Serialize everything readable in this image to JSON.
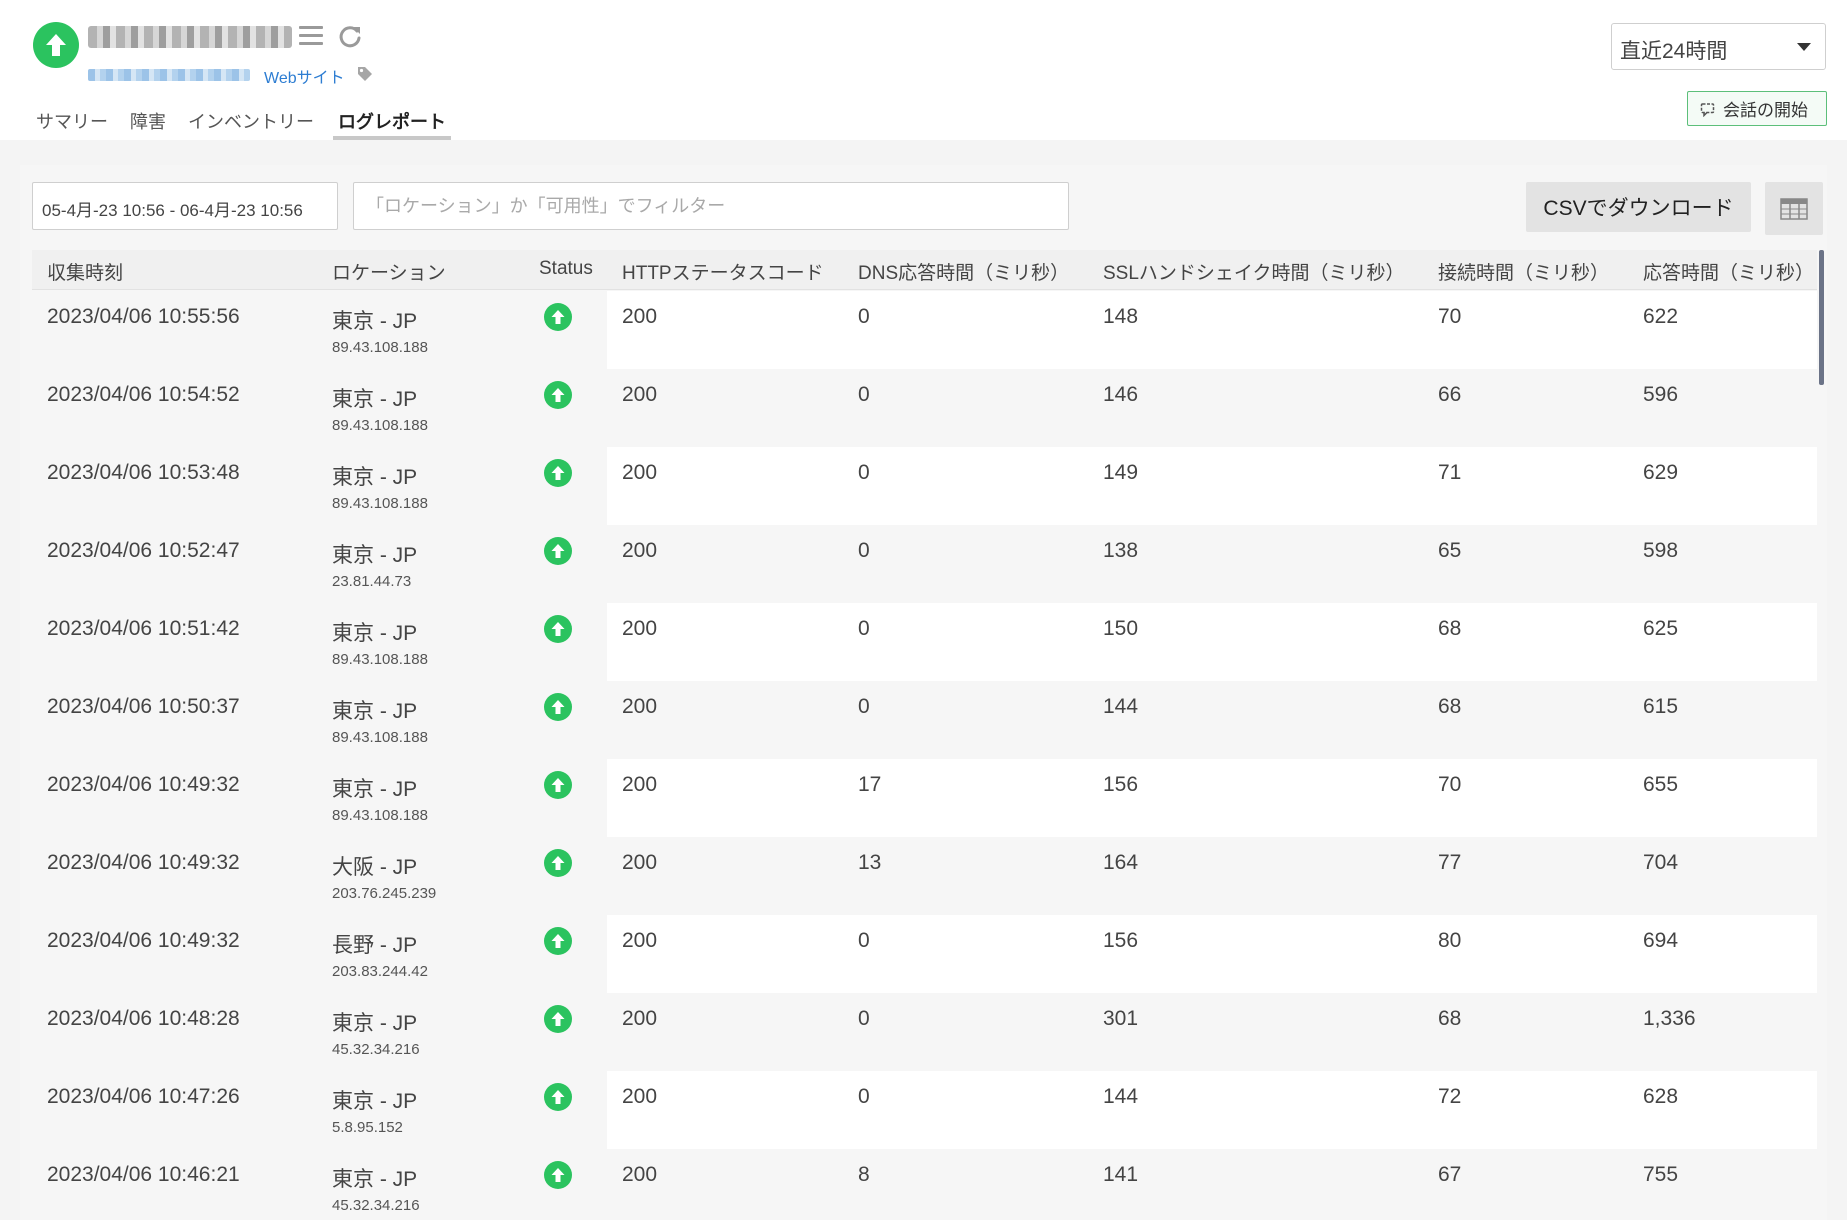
{
  "header": {
    "monitor_type": "Webサイト"
  },
  "tabs": [
    {
      "label": "サマリー",
      "active": false
    },
    {
      "label": "障害",
      "active": false
    },
    {
      "label": "インベントリー",
      "active": false
    },
    {
      "label": "ログレポート",
      "active": true
    }
  ],
  "time_range": {
    "selected": "直近24時間"
  },
  "chat_button": {
    "label": "会話の開始"
  },
  "toolbar": {
    "date_range": "05-4月-23 10:56 - 06-4月-23 10:56",
    "filter_placeholder": "「ロケーション」か「可用性」でフィルター",
    "csv_label": "CSVでダウンロード"
  },
  "colors": {
    "status_up": "#2bc35f",
    "accent_link": "#2d7dd2"
  },
  "table": {
    "columns": {
      "time": "収集時刻",
      "location": "ロケーション",
      "status": "Status",
      "http": "HTTPステータスコード",
      "dns": "DNS応答時間（ミリ秒）",
      "ssl": "SSLハンドシェイク時間（ミリ秒）",
      "connect": "接続時間（ミリ秒）",
      "response": "応答時間（ミリ秒）"
    },
    "rows": [
      {
        "time": "2023/04/06 10:55:56",
        "location": "東京 - JP",
        "ip": "89.43.108.188",
        "status": "up-arrow-icon",
        "http": "200",
        "dns": "0",
        "ssl": "148",
        "connect": "70",
        "response": "622"
      },
      {
        "time": "2023/04/06 10:54:52",
        "location": "東京 - JP",
        "ip": "89.43.108.188",
        "status": "up-arrow-icon",
        "http": "200",
        "dns": "0",
        "ssl": "146",
        "connect": "66",
        "response": "596"
      },
      {
        "time": "2023/04/06 10:53:48",
        "location": "東京 - JP",
        "ip": "89.43.108.188",
        "status": "up-arrow-icon",
        "http": "200",
        "dns": "0",
        "ssl": "149",
        "connect": "71",
        "response": "629"
      },
      {
        "time": "2023/04/06 10:52:47",
        "location": "東京 - JP",
        "ip": "23.81.44.73",
        "status": "up-arrow-icon",
        "http": "200",
        "dns": "0",
        "ssl": "138",
        "connect": "65",
        "response": "598"
      },
      {
        "time": "2023/04/06 10:51:42",
        "location": "東京 - JP",
        "ip": "89.43.108.188",
        "status": "up-arrow-icon",
        "http": "200",
        "dns": "0",
        "ssl": "150",
        "connect": "68",
        "response": "625"
      },
      {
        "time": "2023/04/06 10:50:37",
        "location": "東京 - JP",
        "ip": "89.43.108.188",
        "status": "up-arrow-icon",
        "http": "200",
        "dns": "0",
        "ssl": "144",
        "connect": "68",
        "response": "615"
      },
      {
        "time": "2023/04/06 10:49:32",
        "location": "東京 - JP",
        "ip": "89.43.108.188",
        "status": "up-arrow-icon",
        "http": "200",
        "dns": "17",
        "ssl": "156",
        "connect": "70",
        "response": "655"
      },
      {
        "time": "2023/04/06 10:49:32",
        "location": "大阪 - JP",
        "ip": "203.76.245.239",
        "status": "up-arrow-icon",
        "http": "200",
        "dns": "13",
        "ssl": "164",
        "connect": "77",
        "response": "704"
      },
      {
        "time": "2023/04/06 10:49:32",
        "location": "長野 - JP",
        "ip": "203.83.244.42",
        "status": "up-arrow-icon",
        "http": "200",
        "dns": "0",
        "ssl": "156",
        "connect": "80",
        "response": "694"
      },
      {
        "time": "2023/04/06 10:48:28",
        "location": "東京 - JP",
        "ip": "45.32.34.216",
        "status": "up-arrow-icon",
        "http": "200",
        "dns": "0",
        "ssl": "301",
        "connect": "68",
        "response": "1,336"
      },
      {
        "time": "2023/04/06 10:47:26",
        "location": "東京 - JP",
        "ip": "5.8.95.152",
        "status": "up-arrow-icon",
        "http": "200",
        "dns": "0",
        "ssl": "144",
        "connect": "72",
        "response": "628"
      },
      {
        "time": "2023/04/06 10:46:21",
        "location": "東京 - JP",
        "ip": "45.32.34.216",
        "status": "up-arrow-icon",
        "http": "200",
        "dns": "8",
        "ssl": "141",
        "connect": "67",
        "response": "755"
      }
    ]
  }
}
